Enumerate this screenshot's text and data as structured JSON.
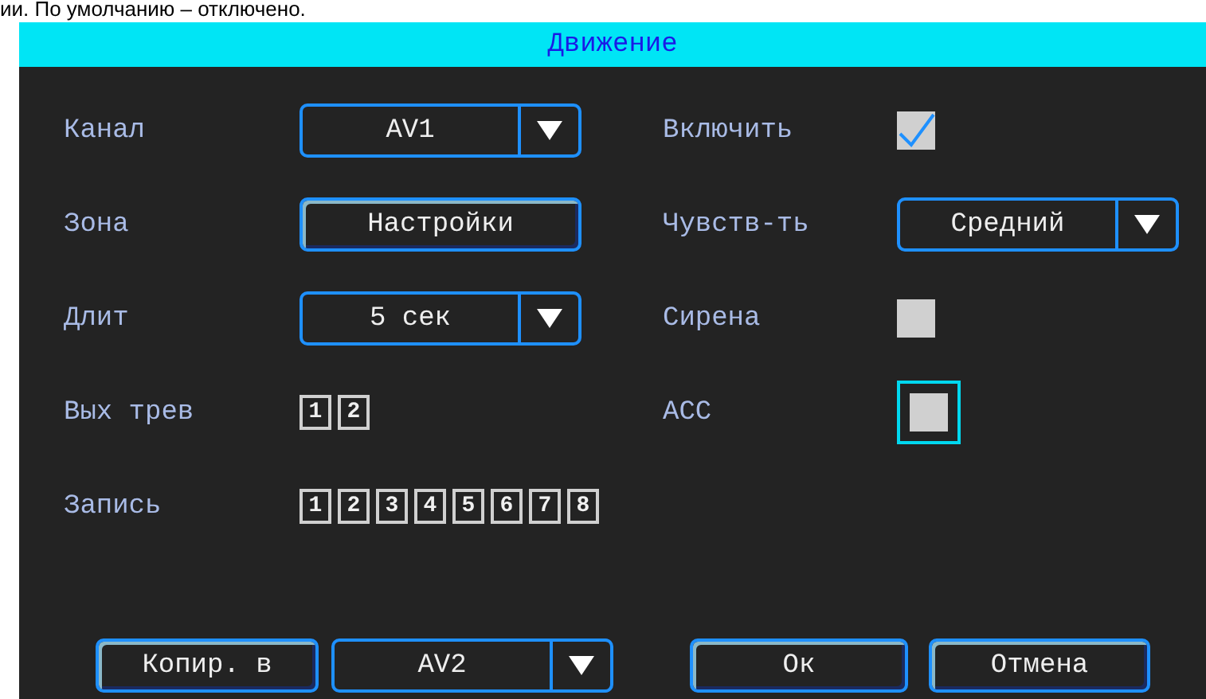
{
  "page_text": "ии. По умолчанию – отключено.",
  "dialog": {
    "title": "Движение",
    "rows": [
      {
        "left": {
          "label": "Канал",
          "control": {
            "kind": "dropdown",
            "value": "AV1"
          }
        },
        "right": {
          "label": "Включить",
          "control": {
            "kind": "checkbox",
            "checked": true,
            "focused": false
          }
        }
      },
      {
        "left": {
          "label": "Зона",
          "control": {
            "kind": "button",
            "value": "Настройки"
          }
        },
        "right": {
          "label": "Чувств-ть",
          "control": {
            "kind": "dropdown",
            "value": "Средний"
          }
        }
      },
      {
        "left": {
          "label": "Длит",
          "control": {
            "kind": "dropdown",
            "value": "5 сек"
          }
        },
        "right": {
          "label": "Сирена",
          "control": {
            "kind": "checkbox",
            "checked": false,
            "focused": false
          }
        }
      },
      {
        "left": {
          "label": "Вых трев",
          "control": {
            "kind": "numbers",
            "items": [
              "1",
              "2"
            ]
          }
        },
        "right": {
          "label": "ACC",
          "control": {
            "kind": "checkbox",
            "checked": false,
            "focused": true
          }
        }
      },
      {
        "left": {
          "label": "Запись",
          "control": {
            "kind": "numbers",
            "items": [
              "1",
              "2",
              "3",
              "4",
              "5",
              "6",
              "7",
              "8"
            ]
          }
        }
      }
    ],
    "footer": [
      {
        "kind": "button",
        "value": "Копир. в"
      },
      {
        "kind": "dropdown",
        "value": "AV2"
      },
      {
        "kind": "button",
        "value": "Ок"
      },
      {
        "kind": "button",
        "value": "Отмена"
      }
    ]
  }
}
